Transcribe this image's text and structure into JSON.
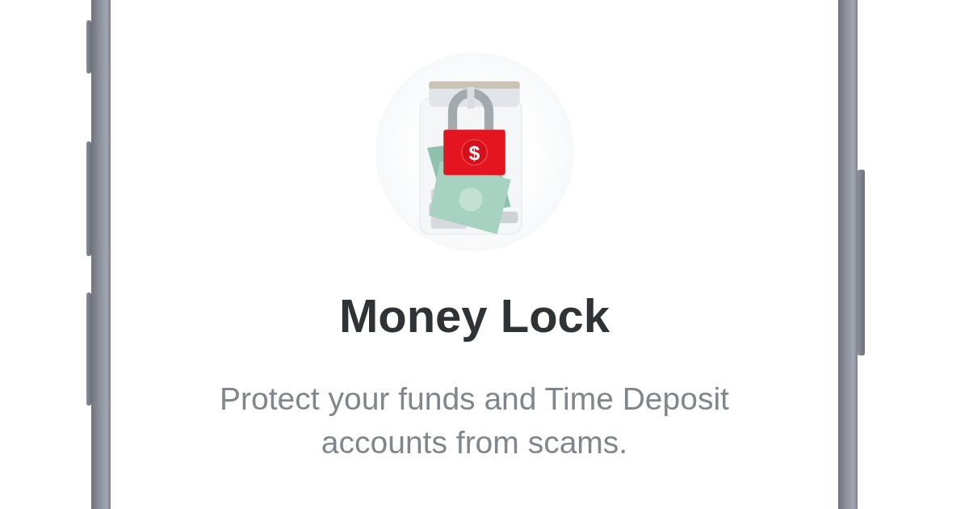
{
  "screen": {
    "lock_symbol": "$",
    "title": "Money Lock",
    "description": "Protect your funds and Time Deposit accounts from scams."
  }
}
